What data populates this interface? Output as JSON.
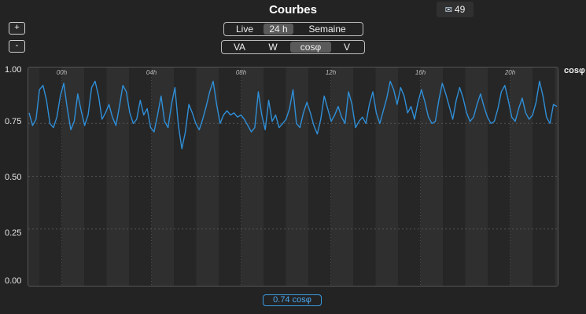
{
  "header": {
    "title": "Courbes"
  },
  "notifications": {
    "icon": "envelope-icon",
    "count": "49"
  },
  "zoom": {
    "plus_label": "+",
    "minus_label": "-"
  },
  "range_selector": {
    "options": [
      {
        "label": "Live",
        "active": false
      },
      {
        "label": "24 h",
        "active": true
      },
      {
        "label": "Semaine",
        "active": false
      }
    ]
  },
  "measure_selector": {
    "options": [
      {
        "label": "VA",
        "active": false
      },
      {
        "label": "W",
        "active": false
      },
      {
        "label": "cosφ",
        "active": true
      },
      {
        "label": "V",
        "active": false
      }
    ]
  },
  "readout": {
    "value": "0.74 cosφ"
  },
  "colors": {
    "line": "#2f8fd8",
    "accent": "#4aa8f0",
    "background": "#232323"
  },
  "chart_data": {
    "type": "line",
    "ylabel": "cosφ",
    "ylim": [
      0,
      1
    ],
    "yticks": [
      "1.00",
      "0.75",
      "0.50",
      "0.25",
      "0.00"
    ],
    "xtick_labels": [
      "00h",
      "04h",
      "08h",
      "12h",
      "16h",
      "20h"
    ],
    "grid": true,
    "series": [
      {
        "values": [
          0.8,
          0.74,
          0.77,
          0.91,
          0.93,
          0.86,
          0.75,
          0.73,
          0.78,
          0.88,
          0.94,
          0.82,
          0.72,
          0.76,
          0.89,
          0.81,
          0.74,
          0.79,
          0.92,
          0.95,
          0.88,
          0.77,
          0.8,
          0.84,
          0.78,
          0.74,
          0.83,
          0.93,
          0.9,
          0.8,
          0.75,
          0.77,
          0.86,
          0.79,
          0.82,
          0.73,
          0.71,
          0.79,
          0.88,
          0.76,
          0.73,
          0.84,
          0.92,
          0.74,
          0.63,
          0.71,
          0.84,
          0.8,
          0.75,
          0.72,
          0.77,
          0.83,
          0.9,
          0.95,
          0.84,
          0.75,
          0.79,
          0.81,
          0.79,
          0.8,
          0.78,
          0.79,
          0.77,
          0.74,
          0.71,
          0.73,
          0.9,
          0.79,
          0.72,
          0.86,
          0.76,
          0.79,
          0.73,
          0.75,
          0.77,
          0.82,
          0.91,
          0.75,
          0.73,
          0.8,
          0.85,
          0.8,
          0.74,
          0.7,
          0.77,
          0.88,
          0.82,
          0.76,
          0.79,
          0.83,
          0.78,
          0.75,
          0.9,
          0.84,
          0.73,
          0.76,
          0.78,
          0.75,
          0.84,
          0.9,
          0.8,
          0.75,
          0.81,
          0.87,
          0.95,
          0.91,
          0.84,
          0.92,
          0.88,
          0.8,
          0.83,
          0.77,
          0.85,
          0.91,
          0.85,
          0.78,
          0.75,
          0.76,
          0.86,
          0.94,
          0.89,
          0.83,
          0.77,
          0.86,
          0.92,
          0.87,
          0.8,
          0.76,
          0.78,
          0.84,
          0.89,
          0.83,
          0.78,
          0.75,
          0.76,
          0.82,
          0.9,
          0.93,
          0.86,
          0.78,
          0.76,
          0.82,
          0.87,
          0.8,
          0.77,
          0.79,
          0.85,
          0.95,
          0.88,
          0.78,
          0.75,
          0.84,
          0.83
        ]
      }
    ]
  }
}
